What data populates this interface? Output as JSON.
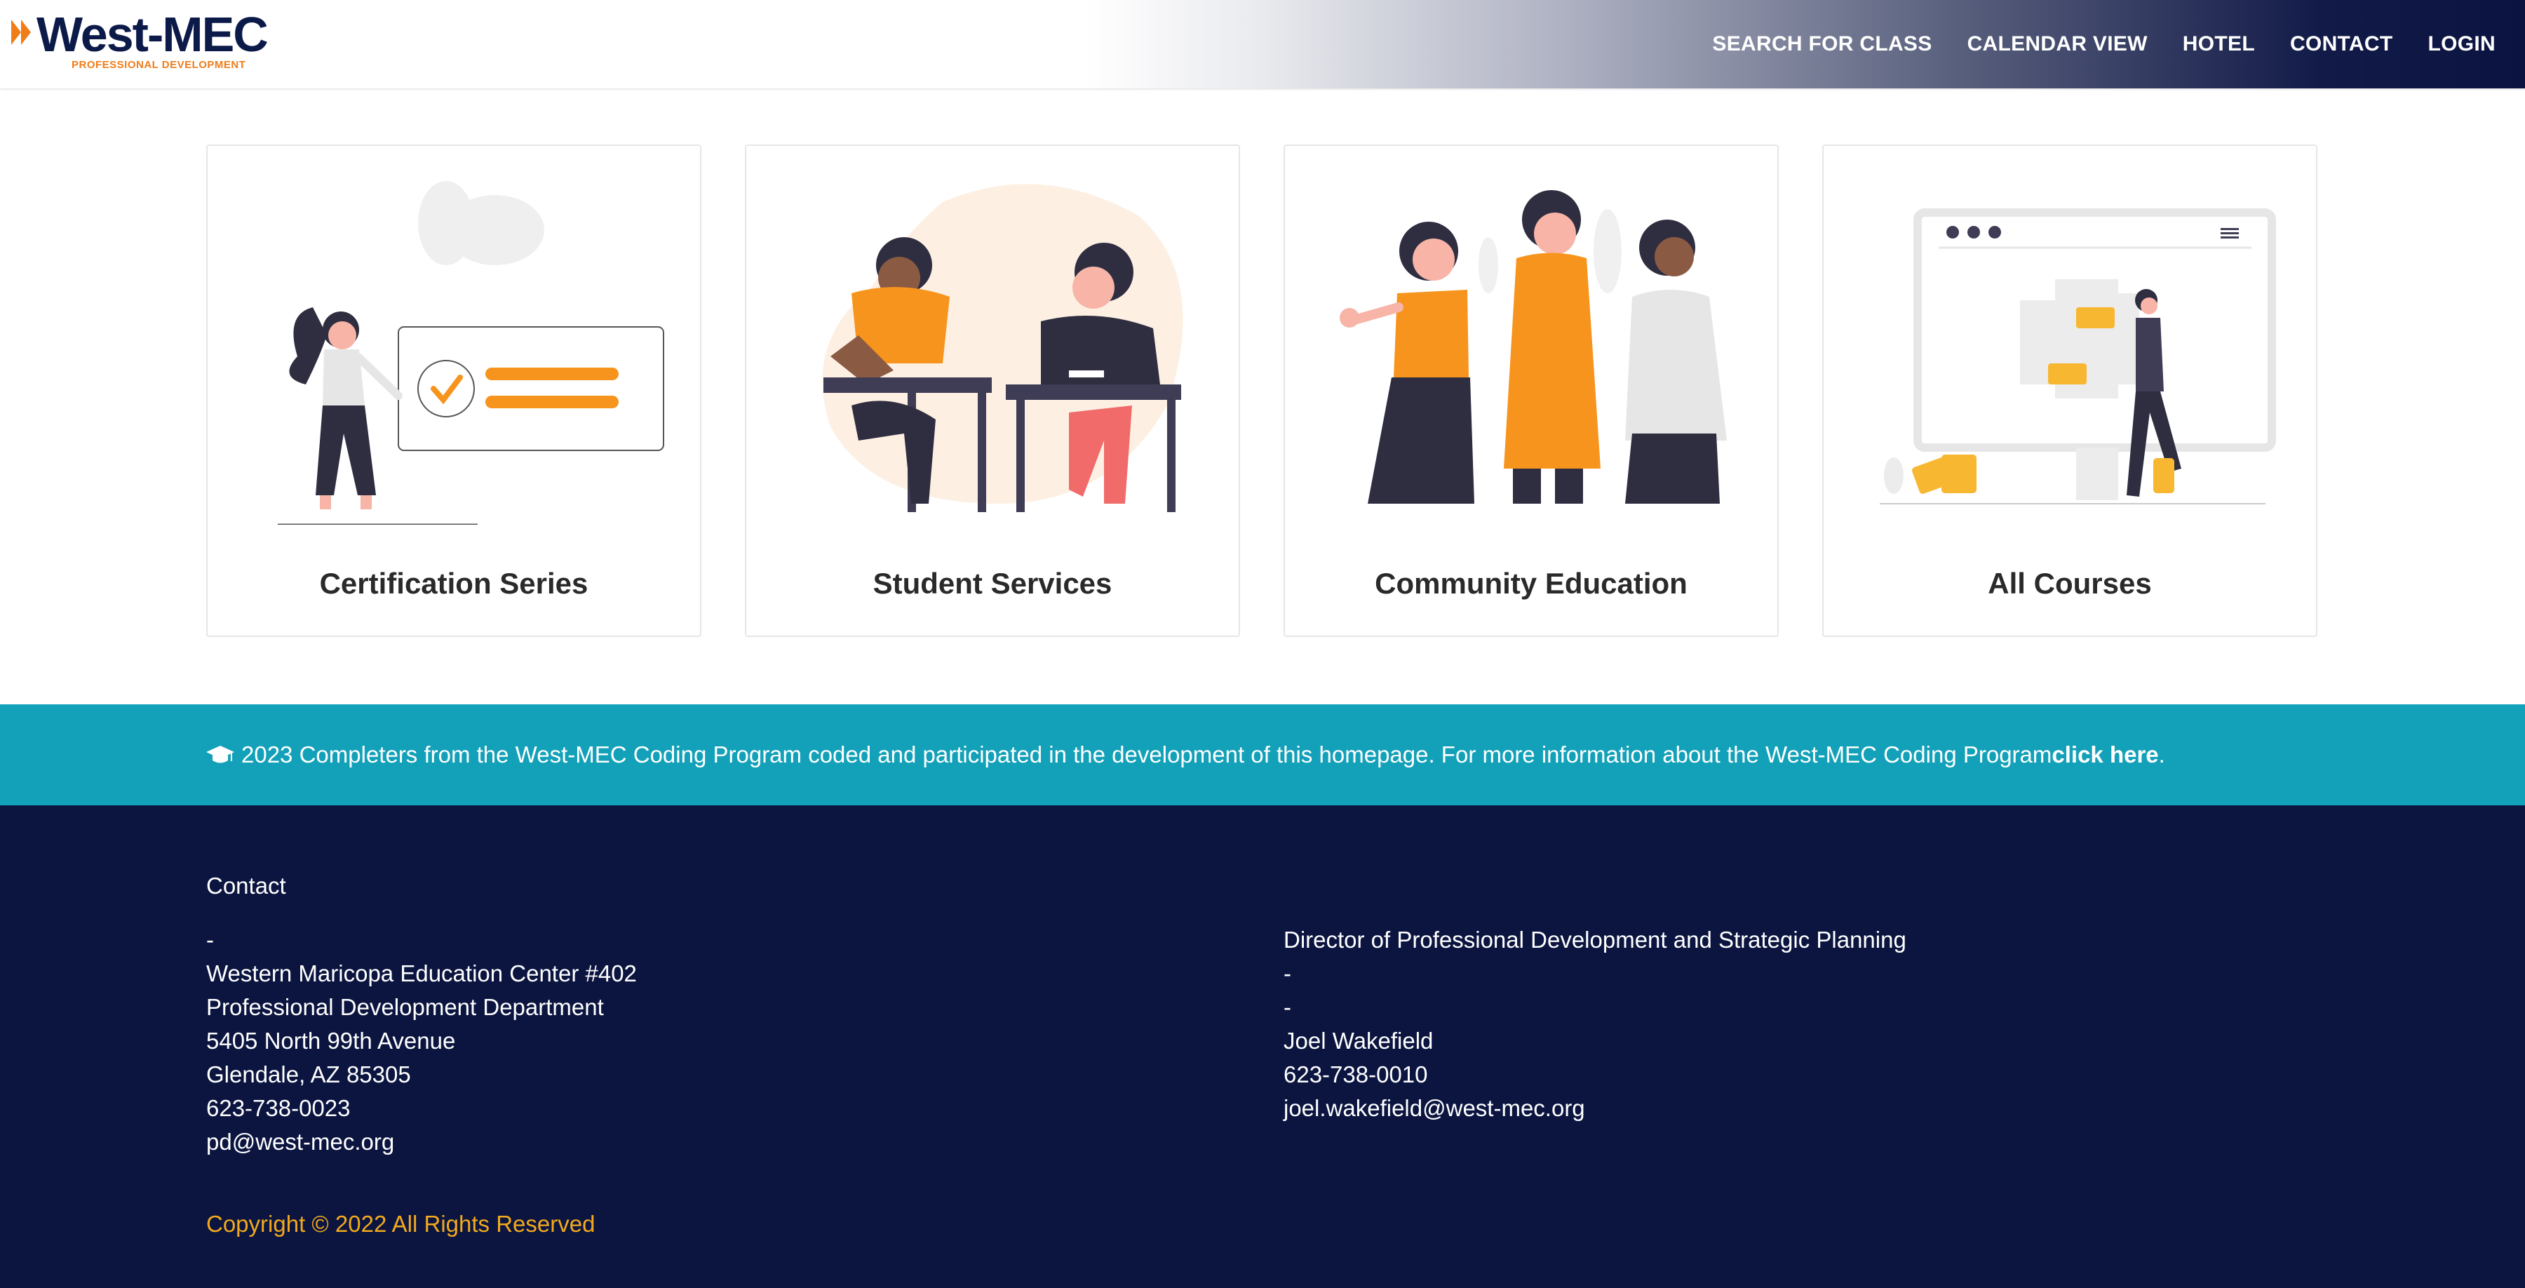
{
  "header": {
    "logo_text": "West-MEC",
    "logo_subtitle": "PROFESSIONAL DEVELOPMENT",
    "nav": [
      {
        "label": "SEARCH FOR CLASS"
      },
      {
        "label": "CALENDAR VIEW"
      },
      {
        "label": "HOTEL"
      },
      {
        "label": "CONTACT"
      },
      {
        "label": "LOGIN"
      }
    ]
  },
  "cards": [
    {
      "title": "Certification Series",
      "illustration": "presentation-checklist-illustration"
    },
    {
      "title": "Student Services",
      "illustration": "students-writing-illustration"
    },
    {
      "title": "Community Education",
      "illustration": "group-of-people-illustration"
    },
    {
      "title": "All Courses",
      "illustration": "browser-building-illustration"
    }
  ],
  "banner": {
    "icon": "graduation-cap-icon",
    "text": "2023 Completers from the West-MEC Coding Program coded and participated in the development of this homepage. For more information about the West-MEC Coding Program ",
    "link": "click here",
    "end": "."
  },
  "footer": {
    "heading": "Contact",
    "left": [
      "-",
      "Western Maricopa Education Center #402",
      "Professional Development Department",
      "5405 North 99th Avenue",
      "Glendale, AZ 85305",
      "623-738-0023",
      "pd@west-mec.org"
    ],
    "right": [
      "Director of Professional Development and Strategic Planning",
      "-",
      "-",
      "Joel Wakefield",
      "623-738-0010",
      "joel.wakefield@west-mec.org"
    ],
    "copyright": "Copyright © 2022 All Rights Reserved"
  },
  "colors": {
    "navy": "#0b1540",
    "orange": "#f7941d",
    "teal": "#13a1b9",
    "gold": "#f2a91d"
  }
}
